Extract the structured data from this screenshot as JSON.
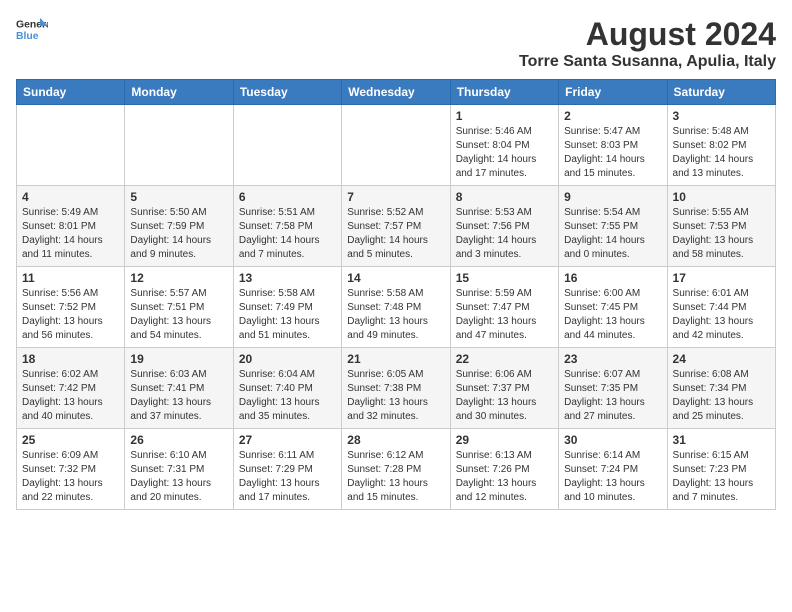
{
  "header": {
    "logo_line1": "General",
    "logo_line2": "Blue",
    "title": "August 2024",
    "subtitle": "Torre Santa Susanna, Apulia, Italy"
  },
  "weekdays": [
    "Sunday",
    "Monday",
    "Tuesday",
    "Wednesday",
    "Thursday",
    "Friday",
    "Saturday"
  ],
  "weeks": [
    [
      {
        "num": "",
        "info": ""
      },
      {
        "num": "",
        "info": ""
      },
      {
        "num": "",
        "info": ""
      },
      {
        "num": "",
        "info": ""
      },
      {
        "num": "1",
        "info": "Sunrise: 5:46 AM\nSunset: 8:04 PM\nDaylight: 14 hours and 17 minutes."
      },
      {
        "num": "2",
        "info": "Sunrise: 5:47 AM\nSunset: 8:03 PM\nDaylight: 14 hours and 15 minutes."
      },
      {
        "num": "3",
        "info": "Sunrise: 5:48 AM\nSunset: 8:02 PM\nDaylight: 14 hours and 13 minutes."
      }
    ],
    [
      {
        "num": "4",
        "info": "Sunrise: 5:49 AM\nSunset: 8:01 PM\nDaylight: 14 hours and 11 minutes."
      },
      {
        "num": "5",
        "info": "Sunrise: 5:50 AM\nSunset: 7:59 PM\nDaylight: 14 hours and 9 minutes."
      },
      {
        "num": "6",
        "info": "Sunrise: 5:51 AM\nSunset: 7:58 PM\nDaylight: 14 hours and 7 minutes."
      },
      {
        "num": "7",
        "info": "Sunrise: 5:52 AM\nSunset: 7:57 PM\nDaylight: 14 hours and 5 minutes."
      },
      {
        "num": "8",
        "info": "Sunrise: 5:53 AM\nSunset: 7:56 PM\nDaylight: 14 hours and 3 minutes."
      },
      {
        "num": "9",
        "info": "Sunrise: 5:54 AM\nSunset: 7:55 PM\nDaylight: 14 hours and 0 minutes."
      },
      {
        "num": "10",
        "info": "Sunrise: 5:55 AM\nSunset: 7:53 PM\nDaylight: 13 hours and 58 minutes."
      }
    ],
    [
      {
        "num": "11",
        "info": "Sunrise: 5:56 AM\nSunset: 7:52 PM\nDaylight: 13 hours and 56 minutes."
      },
      {
        "num": "12",
        "info": "Sunrise: 5:57 AM\nSunset: 7:51 PM\nDaylight: 13 hours and 54 minutes."
      },
      {
        "num": "13",
        "info": "Sunrise: 5:58 AM\nSunset: 7:49 PM\nDaylight: 13 hours and 51 minutes."
      },
      {
        "num": "14",
        "info": "Sunrise: 5:58 AM\nSunset: 7:48 PM\nDaylight: 13 hours and 49 minutes."
      },
      {
        "num": "15",
        "info": "Sunrise: 5:59 AM\nSunset: 7:47 PM\nDaylight: 13 hours and 47 minutes."
      },
      {
        "num": "16",
        "info": "Sunrise: 6:00 AM\nSunset: 7:45 PM\nDaylight: 13 hours and 44 minutes."
      },
      {
        "num": "17",
        "info": "Sunrise: 6:01 AM\nSunset: 7:44 PM\nDaylight: 13 hours and 42 minutes."
      }
    ],
    [
      {
        "num": "18",
        "info": "Sunrise: 6:02 AM\nSunset: 7:42 PM\nDaylight: 13 hours and 40 minutes."
      },
      {
        "num": "19",
        "info": "Sunrise: 6:03 AM\nSunset: 7:41 PM\nDaylight: 13 hours and 37 minutes."
      },
      {
        "num": "20",
        "info": "Sunrise: 6:04 AM\nSunset: 7:40 PM\nDaylight: 13 hours and 35 minutes."
      },
      {
        "num": "21",
        "info": "Sunrise: 6:05 AM\nSunset: 7:38 PM\nDaylight: 13 hours and 32 minutes."
      },
      {
        "num": "22",
        "info": "Sunrise: 6:06 AM\nSunset: 7:37 PM\nDaylight: 13 hours and 30 minutes."
      },
      {
        "num": "23",
        "info": "Sunrise: 6:07 AM\nSunset: 7:35 PM\nDaylight: 13 hours and 27 minutes."
      },
      {
        "num": "24",
        "info": "Sunrise: 6:08 AM\nSunset: 7:34 PM\nDaylight: 13 hours and 25 minutes."
      }
    ],
    [
      {
        "num": "25",
        "info": "Sunrise: 6:09 AM\nSunset: 7:32 PM\nDaylight: 13 hours and 22 minutes."
      },
      {
        "num": "26",
        "info": "Sunrise: 6:10 AM\nSunset: 7:31 PM\nDaylight: 13 hours and 20 minutes."
      },
      {
        "num": "27",
        "info": "Sunrise: 6:11 AM\nSunset: 7:29 PM\nDaylight: 13 hours and 17 minutes."
      },
      {
        "num": "28",
        "info": "Sunrise: 6:12 AM\nSunset: 7:28 PM\nDaylight: 13 hours and 15 minutes."
      },
      {
        "num": "29",
        "info": "Sunrise: 6:13 AM\nSunset: 7:26 PM\nDaylight: 13 hours and 12 minutes."
      },
      {
        "num": "30",
        "info": "Sunrise: 6:14 AM\nSunset: 7:24 PM\nDaylight: 13 hours and 10 minutes."
      },
      {
        "num": "31",
        "info": "Sunrise: 6:15 AM\nSunset: 7:23 PM\nDaylight: 13 hours and 7 minutes."
      }
    ]
  ]
}
